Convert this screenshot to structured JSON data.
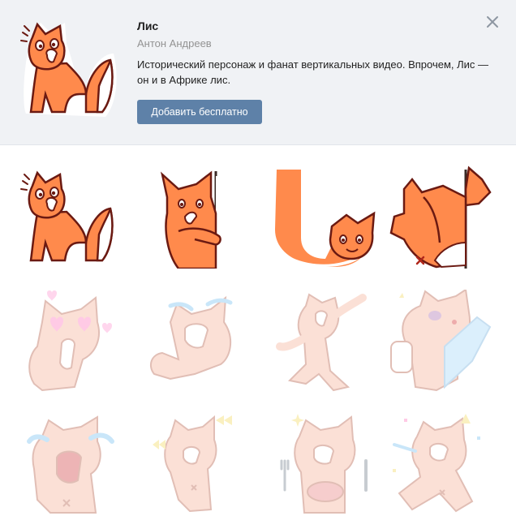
{
  "pack": {
    "title": "Лис",
    "author": "Антон Андреев",
    "description": "Исторический персонаж и фанат вертикальных видео. Впрочем, Лис — он и в Африке лис.",
    "add_button_label": "Добавить бесплатно"
  },
  "icons": {
    "close": "close-icon"
  },
  "colors": {
    "header_bg": "#f0f2f5",
    "button_bg": "#5e81a8",
    "fox_orange": "#ff8a4c",
    "fox_outline": "#6b1a12",
    "preview_pink": "#f9c7b6"
  },
  "stickers": [
    {
      "name": "fox-excited",
      "preview": false
    },
    {
      "name": "fox-peeking",
      "preview": false
    },
    {
      "name": "fox-upside-down",
      "preview": false
    },
    {
      "name": "fox-pressed-to-wall",
      "preview": false
    },
    {
      "name": "fox-in-love",
      "preview": true
    },
    {
      "name": "fox-crying-laughing",
      "preview": true
    },
    {
      "name": "fox-dancing",
      "preview": true
    },
    {
      "name": "fox-bandaged",
      "preview": true
    },
    {
      "name": "fox-sobbing",
      "preview": true
    },
    {
      "name": "fox-butterflies",
      "preview": true
    },
    {
      "name": "fox-eating",
      "preview": true
    },
    {
      "name": "fox-party",
      "preview": true
    }
  ]
}
